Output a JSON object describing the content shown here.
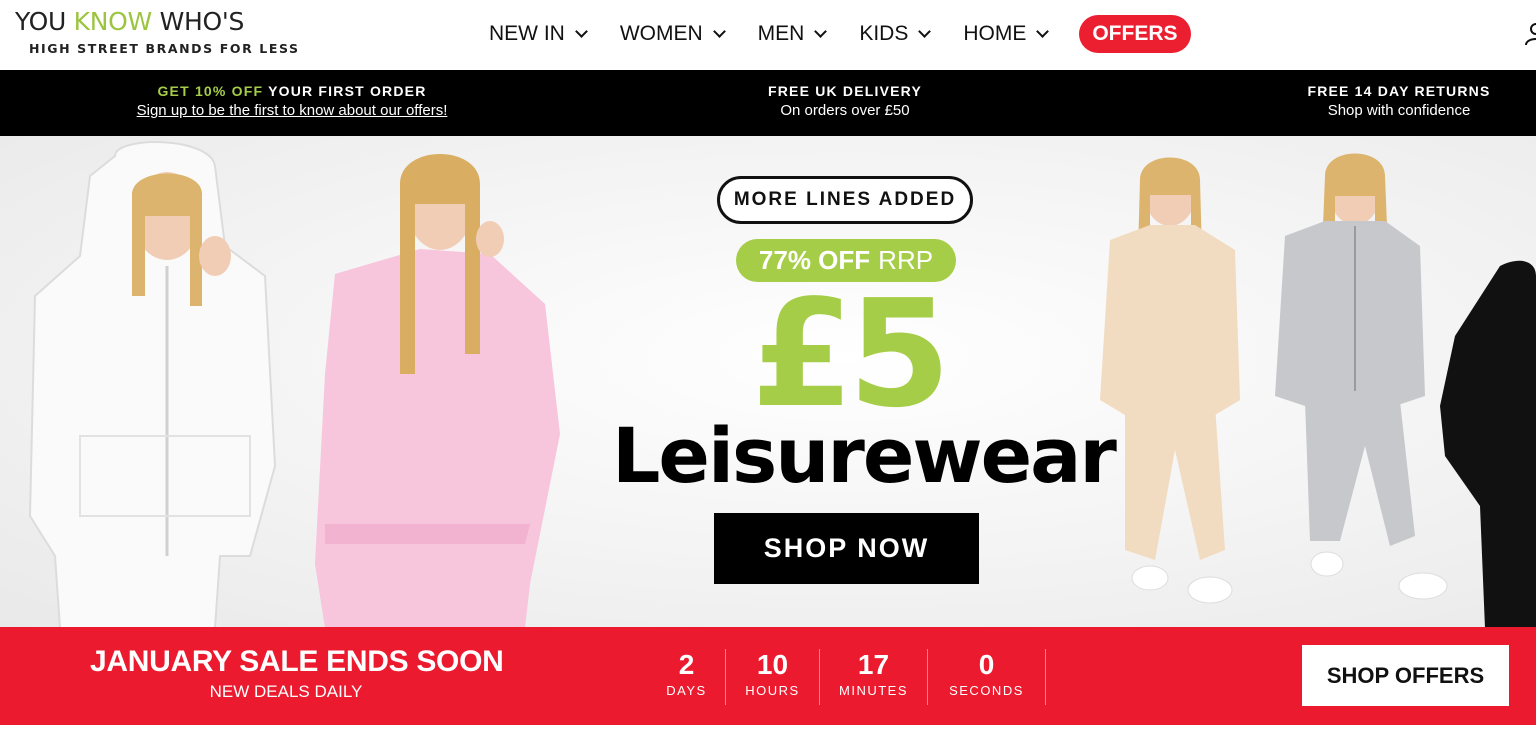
{
  "logo": {
    "word1": "YOU ",
    "word2": "KNOW",
    "word3": " WHO'S",
    "tagline": "HIGH STREET BRANDS FOR LESS"
  },
  "nav": {
    "items": [
      {
        "label": "NEW IN",
        "icon": "chevron-down-icon"
      },
      {
        "label": "WOMEN",
        "icon": "chevron-down-icon"
      },
      {
        "label": "MEN",
        "icon": "chevron-down-icon"
      },
      {
        "label": "KIDS",
        "icon": "chevron-down-icon"
      },
      {
        "label": "HOME",
        "icon": "chevron-down-icon"
      }
    ],
    "offers_label": "OFFERS",
    "account_icon": "user-icon"
  },
  "usp": {
    "item1_title_green": "GET 10% OFF",
    "item1_title_rest": " YOUR FIRST ORDER",
    "item1_sub": "Sign up to be the first to know about our offers!",
    "item2_title": "FREE UK DELIVERY",
    "item2_sub": "On orders over £50",
    "item3_title": "FREE 14 DAY RETURNS",
    "item3_sub": "Shop with confidence"
  },
  "hero": {
    "badge": "MORE LINES ADDED",
    "discount_bold": "77% OFF",
    "discount_thin": "RRP",
    "price": "£5",
    "headline": "Leisurewear",
    "cta": "SHOP NOW"
  },
  "sale": {
    "title": "JANUARY SALE ENDS SOON",
    "subtitle": "NEW DEALS DAILY",
    "countdown": [
      {
        "value": "2",
        "label": "DAYS"
      },
      {
        "value": "10",
        "label": "HOURS"
      },
      {
        "value": "17",
        "label": "MINUTES"
      },
      {
        "value": "0",
        "label": "SECONDS"
      }
    ],
    "cta": "SHOP OFFERS"
  },
  "colors": {
    "brand_green": "#a5cd47",
    "offer_red": "#ec1f30",
    "sale_red": "#ec1a2e",
    "black": "#000000"
  }
}
